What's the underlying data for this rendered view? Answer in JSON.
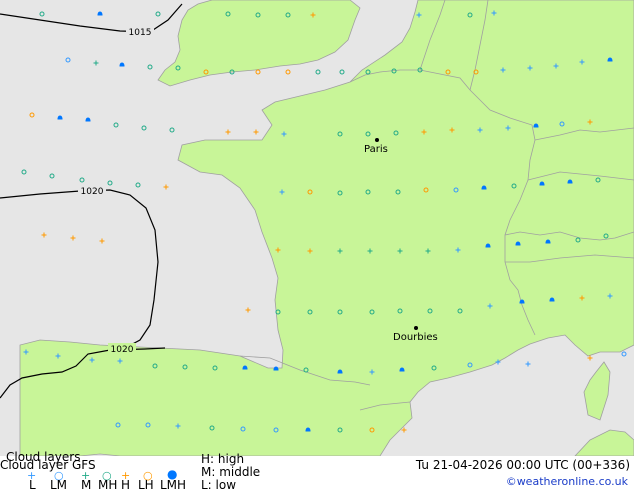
{
  "map": {
    "colors": {
      "sea": "#e6e6e6",
      "land": "#c8f598",
      "border": "#a0a0a0",
      "isobar": "#000000"
    },
    "isobars": [
      {
        "label": "1015"
      },
      {
        "label": "1020"
      },
      {
        "label": "1020"
      }
    ],
    "cities": [
      {
        "name": "Paris"
      },
      {
        "name": "Dourbies"
      }
    ]
  },
  "legend": {
    "title": "Cloud layers",
    "model_line": "Cloud layer  GFS",
    "codes": [
      "L",
      "LM",
      "M",
      "MH",
      "H",
      "LH",
      "LMH"
    ],
    "key": [
      "H: high",
      "M: middle",
      "L: low"
    ],
    "valid_time": "Tu 21-04-2026 00:00 UTC (00+336)",
    "credit": "©weatheronline.co.uk",
    "symbol_colors": {
      "low": "#3399ff",
      "mid": "#22aa88",
      "high": "#ff9900",
      "lmh": "#0077ff"
    }
  }
}
